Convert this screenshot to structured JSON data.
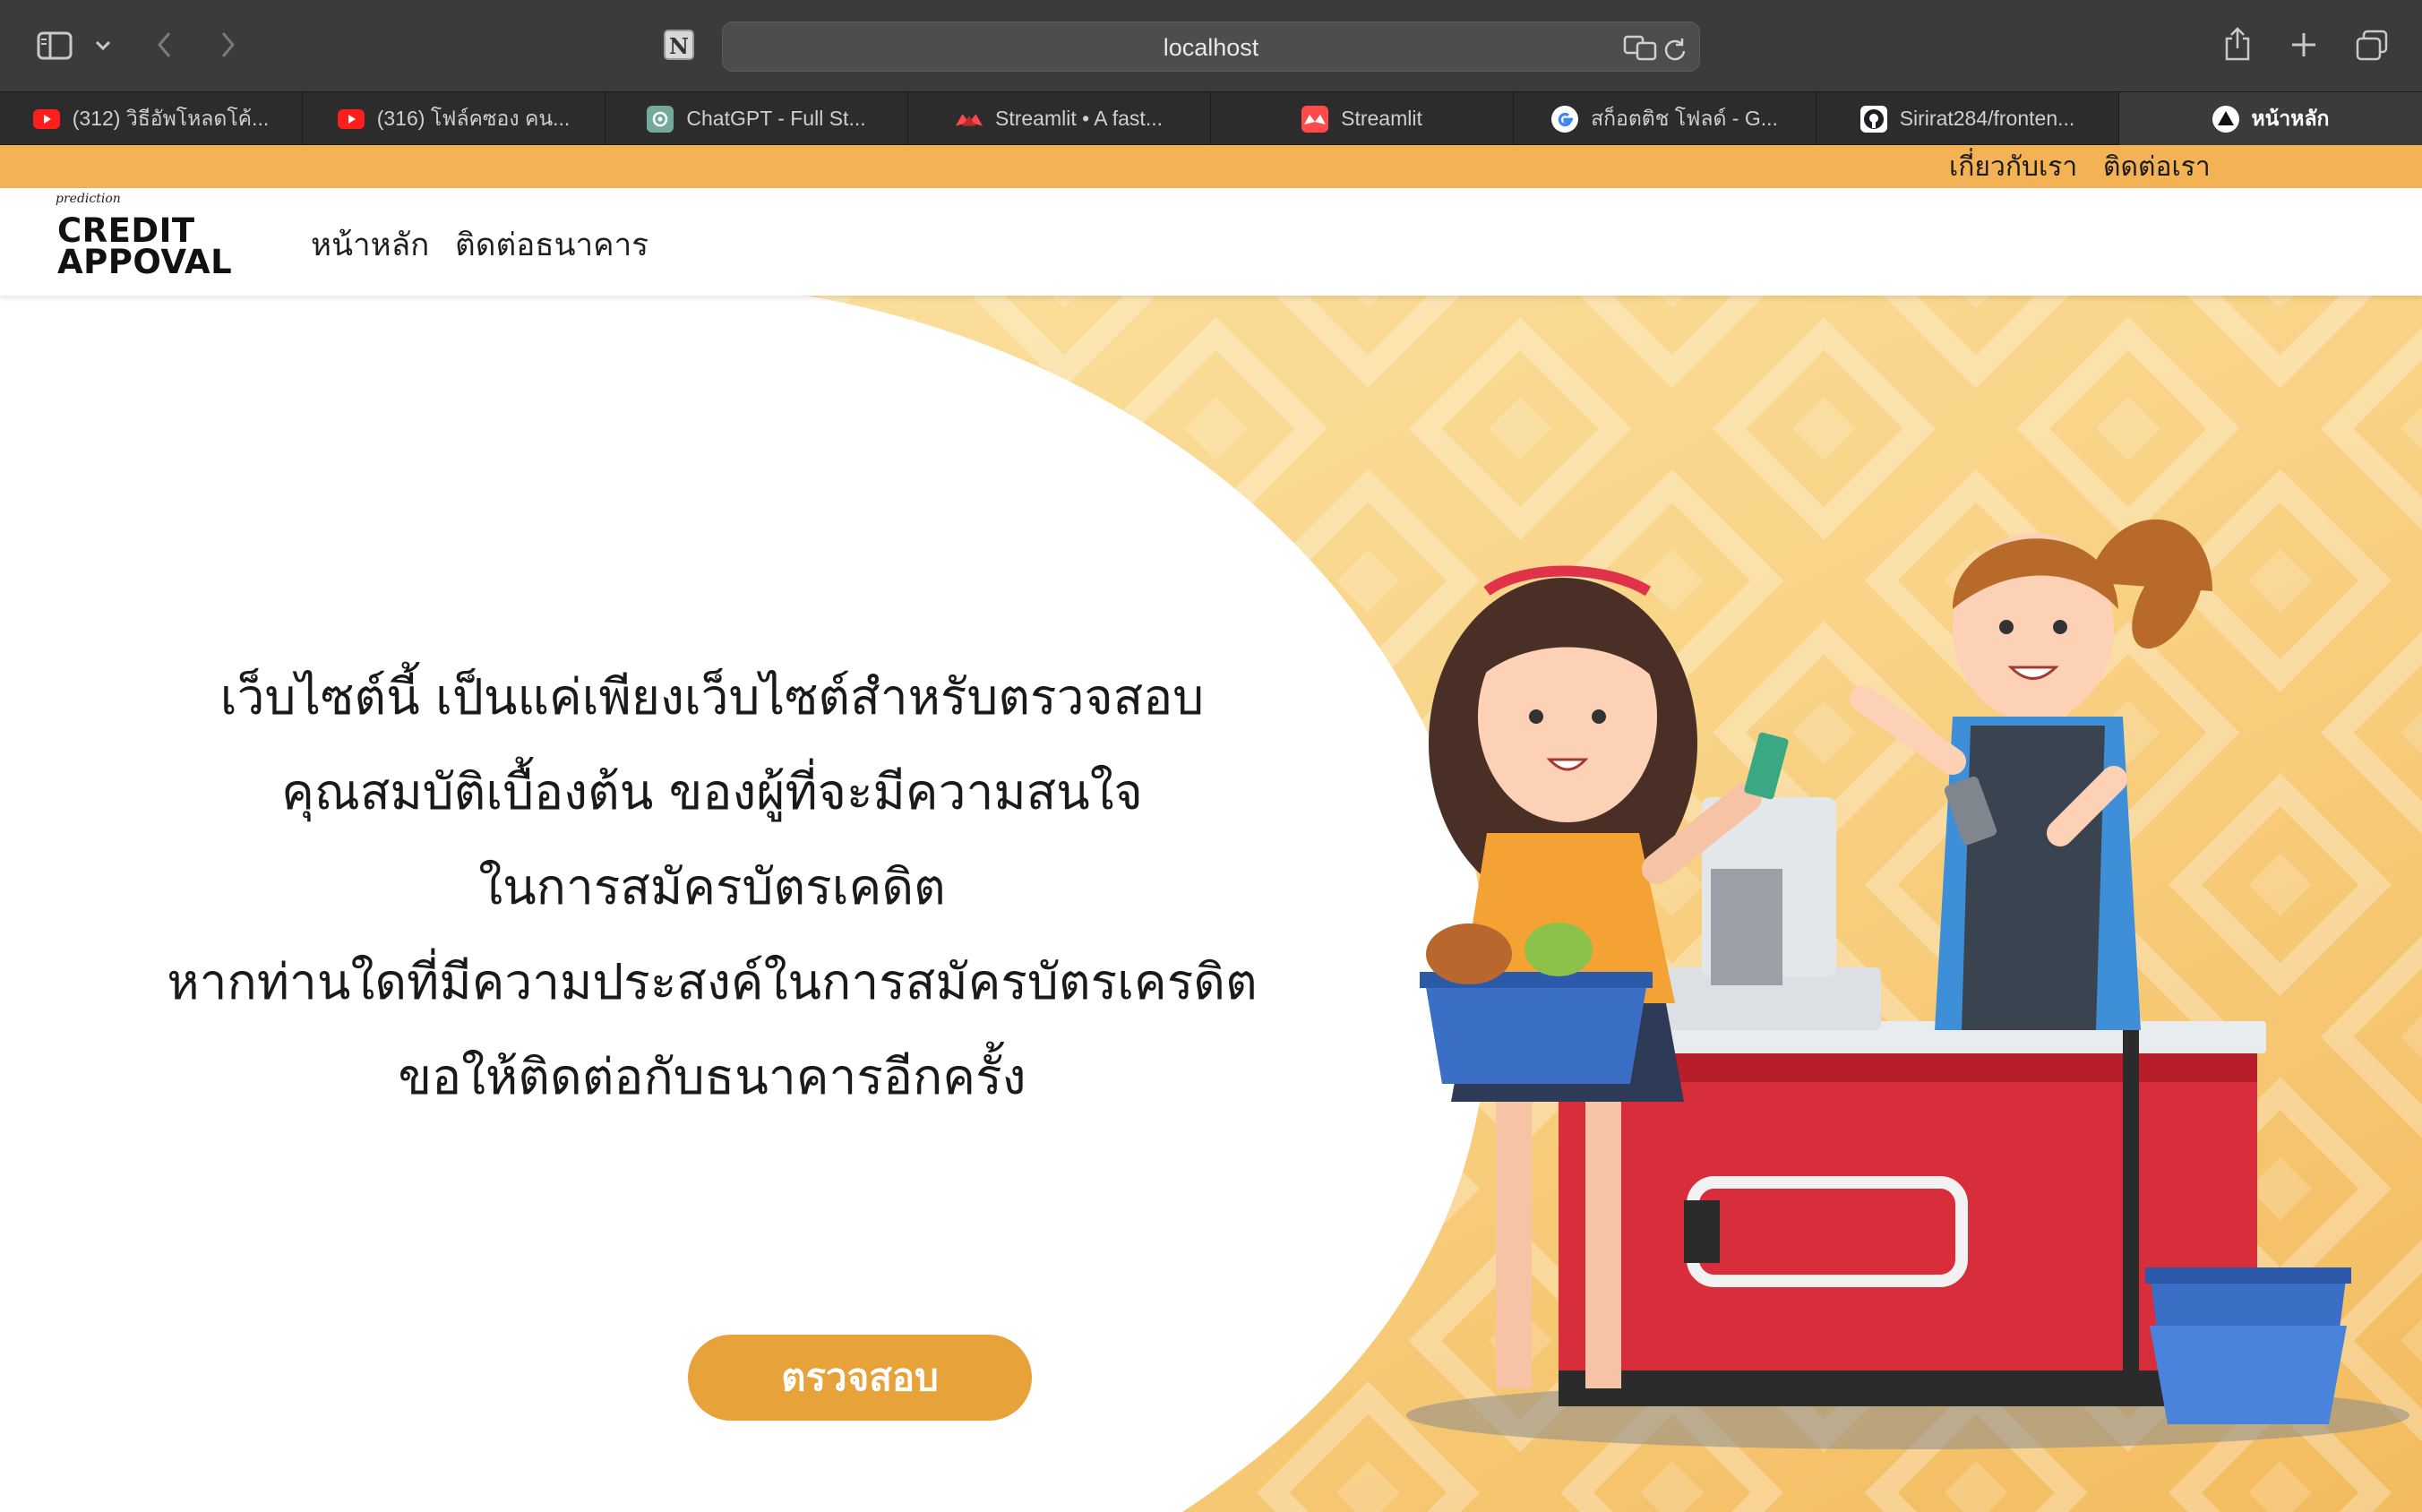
{
  "browser": {
    "url": "localhost",
    "tabs": [
      {
        "label": "(312) วิธีอัพโหลดโค้...",
        "icon": "youtube-icon"
      },
      {
        "label": "(316) โฟล์คซอง คน...",
        "icon": "youtube-icon"
      },
      {
        "label": "ChatGPT - Full St...",
        "icon": "chatgpt-icon"
      },
      {
        "label": "Streamlit • A fast...",
        "icon": "streamlit-icon"
      },
      {
        "label": "Streamlit",
        "icon": "streamlit-icon"
      },
      {
        "label": "สก็อตติช โฟลด์ - G...",
        "icon": "google-icon"
      },
      {
        "label": "Sirirat284/fronten...",
        "icon": "github-icon"
      },
      {
        "label": "หน้าหลัก",
        "icon": "app-icon",
        "active": true
      }
    ]
  },
  "top_bar": {
    "about": "เกี่ยวกับเรา",
    "contact": "ติดต่อเรา",
    "color": "#f3b254"
  },
  "nav": {
    "logo_small": "prediction",
    "logo_line1": "CREDIT",
    "logo_line2": "APPOVAL",
    "home": "หน้าหลัก",
    "contact_bank": "ติดต่อธนาคาร"
  },
  "hero": {
    "lines": [
      "เว็บไซต์นี้ เป็นแค่เพียงเว็บไซต์สำหรับตรวจสอบ",
      "คุณสมบัติเบื้องต้น ของผู้ที่จะมีความสนใจ",
      "ในการสมัครบัตรเคดิต",
      "หากท่านใดที่มีความประสงค์ในการสมัครบัตรเครดิต",
      "ขอให้ติดต่อกับธนาคารอีกครั้ง"
    ],
    "button": "ตรวจสอบ",
    "button_color": "#e8a23a"
  }
}
